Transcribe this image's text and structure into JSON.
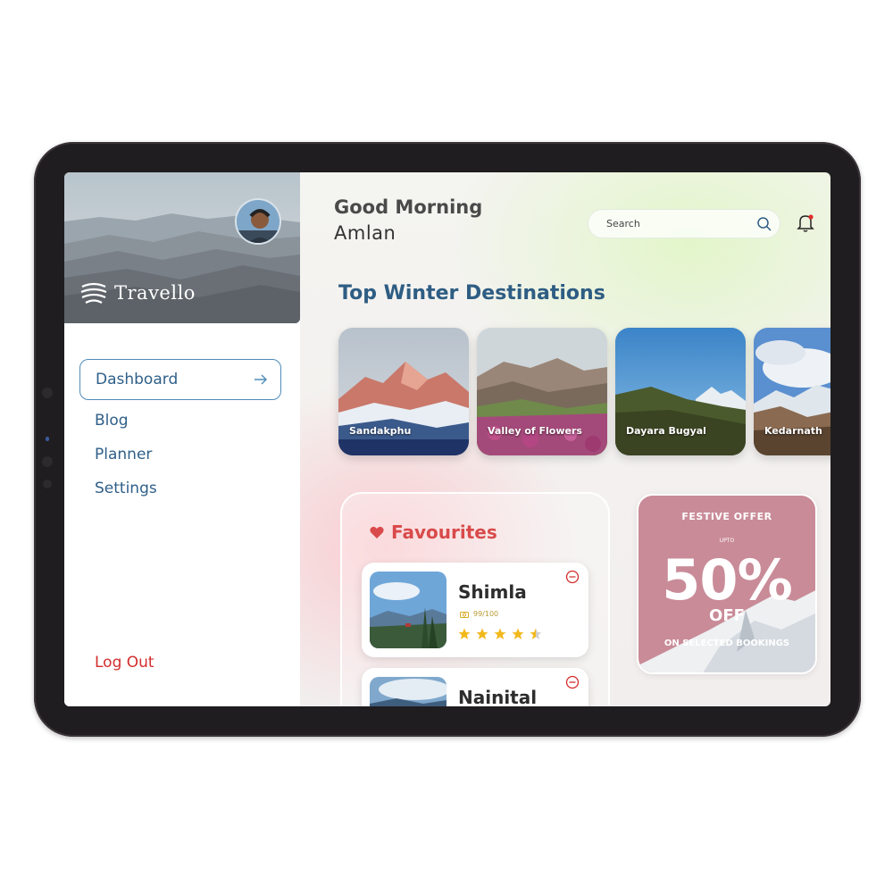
{
  "app": {
    "name": "Travello"
  },
  "header": {
    "greeting": "Good Morning",
    "user_name": "Amlan"
  },
  "search": {
    "placeholder": "Search"
  },
  "nav": {
    "items": [
      {
        "label": "Dashboard",
        "active": true
      },
      {
        "label": "Blog"
      },
      {
        "label": "Planner"
      },
      {
        "label": "Settings"
      }
    ],
    "logout": "Log Out"
  },
  "destinations": {
    "title": "Top Winter Destinations",
    "items": [
      {
        "name": "Sandakphu"
      },
      {
        "name": "Valley of Flowers"
      },
      {
        "name": "Dayara Bugyal"
      },
      {
        "name": "Kedarnath"
      }
    ]
  },
  "favourites": {
    "title": "Favourites",
    "items": [
      {
        "name": "Shimla",
        "meta": "99/100",
        "rating": 4.5
      },
      {
        "name": "Nainital"
      }
    ]
  },
  "offer": {
    "heading": "FESTIVE OFFER",
    "upto": "UPTO",
    "percent": "50%",
    "off": "OFF",
    "note": "ON SELECTED BOOKINGS"
  },
  "colors": {
    "accent": "#2e5d83",
    "nav_text": "#2f5f88",
    "logout": "#d32d2d",
    "favourites": "#d94a4a",
    "star": "#f2b91d",
    "offer_bg": "#c98b98"
  },
  "icons": [
    "logo-icon",
    "arrow-right-icon",
    "search-icon",
    "bell-icon",
    "heart-icon",
    "camera-icon",
    "star-icon",
    "remove-circle-icon"
  ]
}
